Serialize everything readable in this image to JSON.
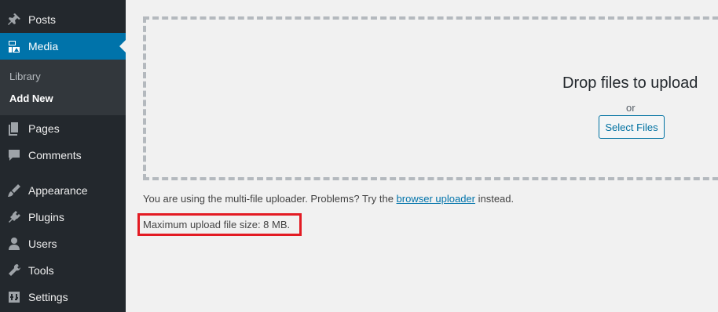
{
  "sidebar": {
    "items": [
      {
        "label": "Posts",
        "icon": "pushpin-icon"
      },
      {
        "label": "Media",
        "icon": "media-icon",
        "active": true
      },
      {
        "label": "Pages",
        "icon": "pages-icon"
      },
      {
        "label": "Comments",
        "icon": "comment-icon"
      },
      {
        "label": "Appearance",
        "icon": "paintbrush-icon"
      },
      {
        "label": "Plugins",
        "icon": "plugin-icon"
      },
      {
        "label": "Users",
        "icon": "user-icon"
      },
      {
        "label": "Tools",
        "icon": "wrench-icon"
      },
      {
        "label": "Settings",
        "icon": "settings-icon"
      }
    ],
    "submenu": [
      {
        "label": "Library"
      },
      {
        "label": "Add New",
        "current": true
      }
    ],
    "active_color": "#0073aa",
    "background": "#23282d"
  },
  "uploader": {
    "drop_title": "Drop files to upload",
    "or_text": "or",
    "select_button": "Select Files",
    "note_prefix": "You are using the multi-file uploader. Problems? Try the ",
    "note_link": "browser uploader",
    "note_suffix": " instead.",
    "max_size": "Maximum upload file size: 8 MB.",
    "highlight_color": "#e31b23"
  }
}
